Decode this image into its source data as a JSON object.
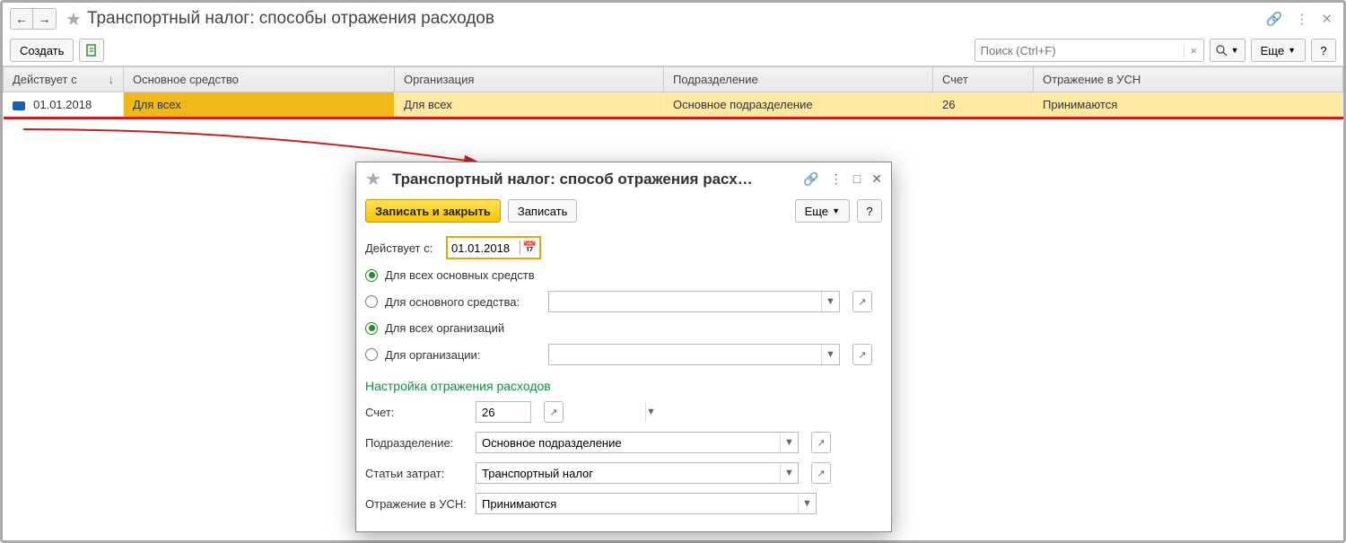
{
  "page": {
    "title": "Транспортный налог: способы отражения расходов"
  },
  "toolbar": {
    "create": "Создать",
    "search_placeholder": "Поиск (Ctrl+F)",
    "more": "Еще"
  },
  "table": {
    "headers": {
      "date": "Действует с",
      "asset": "Основное средство",
      "org": "Организация",
      "unit": "Подразделение",
      "account": "Счет",
      "usn": "Отражение в УСН"
    },
    "rows": [
      {
        "date": "01.01.2018",
        "asset": "Для всех",
        "org": "Для всех",
        "unit": "Основное подразделение",
        "account": "26",
        "usn": "Принимаются"
      }
    ]
  },
  "dialog": {
    "title": "Транспортный налог: способ отражения расх…",
    "save_close": "Записать и закрыть",
    "save": "Записать",
    "more": "Еще",
    "date_label": "Действует с:",
    "date_value": "01.01.2018",
    "radio_all_assets": "Для всех основных средств",
    "radio_one_asset": "Для основного средства:",
    "radio_all_orgs": "Для всех организаций",
    "radio_one_org": "Для организации:",
    "section": "Настройка отражения расходов",
    "account_label": "Счет:",
    "account_value": "26",
    "unit_label": "Подразделение:",
    "unit_value": "Основное подразделение",
    "cost_label": "Статьи затрат:",
    "cost_value": "Транспортный налог",
    "usn_label": "Отражение в УСН:",
    "usn_value": "Принимаются"
  }
}
